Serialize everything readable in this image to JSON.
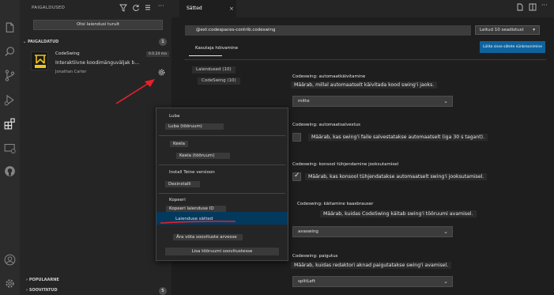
{
  "activity_bar": {
    "icons": [
      "files-icon",
      "search-icon",
      "source-control-icon",
      "run-debug-icon",
      "extensions-icon",
      "remote-explorer-icon",
      "github-icon",
      "account-icon",
      "settings-gear-icon"
    ]
  },
  "sidebar": {
    "title": "PAIGALDUSED",
    "search_placeholder": "Otsi laiendusi turult",
    "installed_header": "PAIGALDATUD",
    "installed_count": "1",
    "extension": {
      "name": "CodeSwing",
      "version": "0.0.24 ma",
      "description": "Interaktiivne koodimänguväljak b...",
      "publisher": "Jonathan Carter"
    },
    "popular_header": "POPULAARNE",
    "recommended_header": "SOOVITATUD",
    "recommended_count": "5"
  },
  "editor": {
    "tab_label": "Sätted",
    "tab_close": "×"
  },
  "settings": {
    "search_value": "@ext:codespaces-contrib.codeswing",
    "found_label": "Leitud 10 seadistust",
    "user_tab": "Kasutaja hõivamine",
    "sync_button": "Lülita sisse sätete sünkroonimine",
    "toc": [
      "Laiendused (10)",
      "CodeSwing (10)"
    ],
    "items": [
      {
        "title": "Codeswing: automaatkäivitamine",
        "desc": "Määrab, millal automaatselt käivitada kood swing'i jaoks.",
        "select": "mitte"
      },
      {
        "title": "Codeswing: automaatsalvestus",
        "desc": "Määrab, kas swing'i faile salvestatakse automaatselt (iga 30 s tagant)."
      },
      {
        "title": "Codeswing: konsool tühjendamine jooksutamisel",
        "desc": "Määrab, kas konsool tühjendatakse automaatselt swing'i jooksutamisel."
      },
      {
        "title": "Codeswing: käitamine kaasbrauser",
        "desc": "Määrab, kuidas CodeSwing käitab swing'i tööruumi avamisel.",
        "select": "avaswing"
      },
      {
        "title": "Codeswing: paigutus",
        "desc": "Määrab, kuidas redaktori aknad paigutatakse swing'i avamisel.",
        "select": "splitLeft"
      }
    ]
  },
  "context_menu": {
    "items": [
      {
        "label": "Luba",
        "chip": false
      },
      {
        "label": "Luba (tööruum)",
        "chip": true
      },
      {
        "label": "Keela",
        "chip": true
      },
      {
        "label": "Keela (tööruum)",
        "chip": true
      },
      {
        "label": "Install Teine versioon",
        "chip": false
      },
      {
        "label": "Desinstalli",
        "chip": true
      },
      {
        "label": "Kopeeri",
        "chip": false
      },
      {
        "label": "Kopeeri laienduse ID",
        "chip": true
      },
      {
        "label": "Laienduse sätted",
        "chip": false
      },
      {
        "label": "Ära võta soovituste arvesse",
        "chip": true
      },
      {
        "label": "Lisa tööruumi soovitustesse",
        "chip": true
      }
    ]
  },
  "annotation": {
    "arrow_color": "#e8202a",
    "underline_color": "#e8202a"
  }
}
